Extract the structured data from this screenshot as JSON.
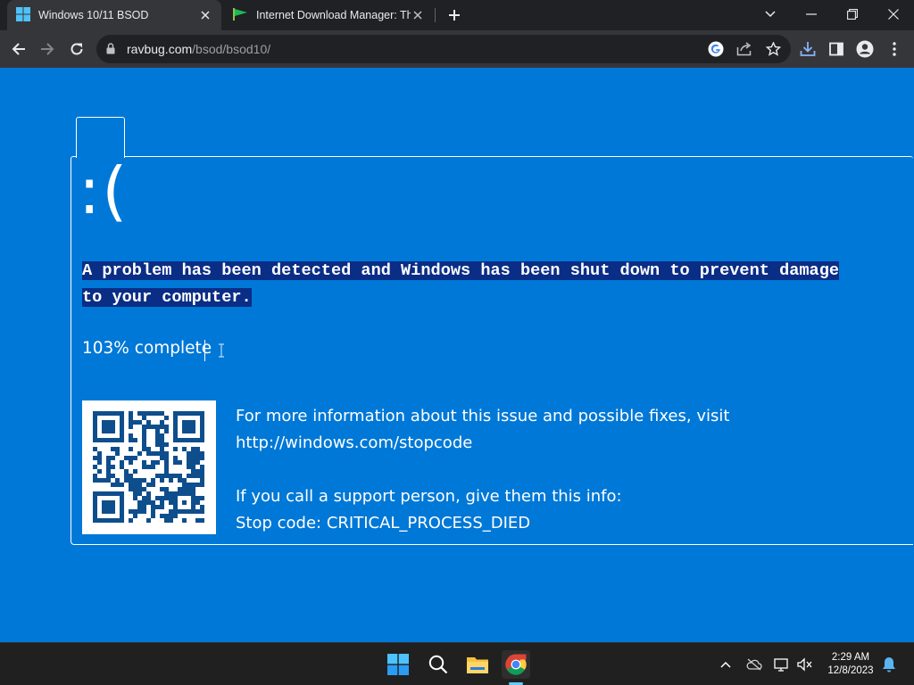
{
  "browser": {
    "tabs": [
      {
        "title": "Windows 10/11 BSOD",
        "icon": "windows-logo-icon",
        "active": true
      },
      {
        "title": "Internet Download Manager: The",
        "icon": "idm-flag-icon",
        "active": false
      }
    ],
    "address": {
      "domain": "ravbug.com",
      "path": "/bsod/bsod10/"
    }
  },
  "bsod": {
    "face": ":(",
    "message": "A problem has been detected and Windows has been shut down to prevent damage to your computer.",
    "progress": "103% complete",
    "info_line1": "For more information about this issue and possible fixes, visit",
    "info_url": "http://windows.com/stopcode",
    "support_line": "If you call a support person, give them this info:",
    "stop_code": "Stop code: CRITICAL_PROCESS_DIED"
  },
  "taskbar": {
    "pinned": [
      "start-icon",
      "search-icon",
      "file-explorer-icon",
      "chrome-icon"
    ],
    "time": "2:29 AM",
    "date": "12/8/2023"
  },
  "colors": {
    "bsod_blue": "#0078d7",
    "selection": "#0a2d86",
    "chrome_dark": "#202124",
    "chrome_toolbar": "#35363a"
  }
}
